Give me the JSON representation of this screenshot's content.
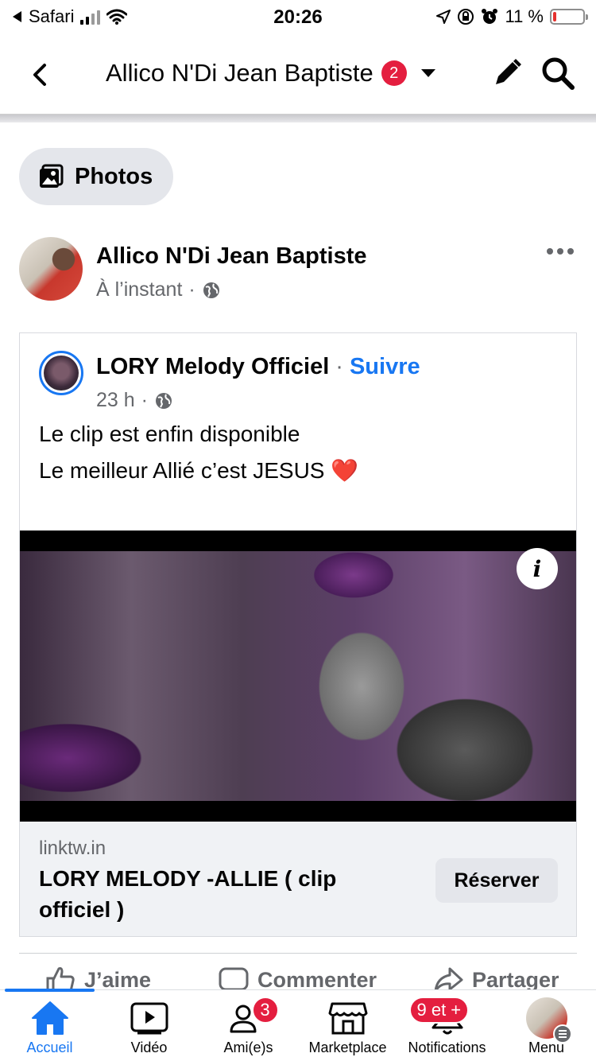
{
  "status_bar": {
    "back_app": "Safari",
    "time": "20:26",
    "battery_percent": "11 %",
    "battery_level": 0.11
  },
  "header": {
    "title": "Allico N'Di Jean Baptiste",
    "badge_count": "2"
  },
  "photos_chip": {
    "label": "Photos"
  },
  "post": {
    "author": "Allico N'Di Jean Baptiste",
    "time": "À l’instant",
    "audience": "·"
  },
  "shared": {
    "page_name": "LORY Melody Officiel",
    "separator": "·",
    "follow_label": "Suivre",
    "time": "23 h",
    "dot": "·",
    "text_line1": "Le clip est enfin disponible",
    "text_line2": "Le meilleur Allié c’est JESUS",
    "heart": "❤️",
    "info_glyph": "i",
    "link": {
      "domain": "linktw.in",
      "title": "LORY MELODY -ALLIE ( clip officiel )",
      "button": "Réserver"
    }
  },
  "actions": {
    "like": "J’aime",
    "comment": "Commenter",
    "share": "Partager"
  },
  "tabbar": {
    "home": "Accueil",
    "video": "Vidéo",
    "friends": "Ami(e)s",
    "friends_badge": "3",
    "marketplace": "Marketplace",
    "notifications": "Notifications",
    "notifications_badge": "9 et +",
    "menu": "Menu"
  },
  "colors": {
    "accent": "#1877f2",
    "badge": "#e41e3f",
    "secondary_text": "#65676b"
  }
}
